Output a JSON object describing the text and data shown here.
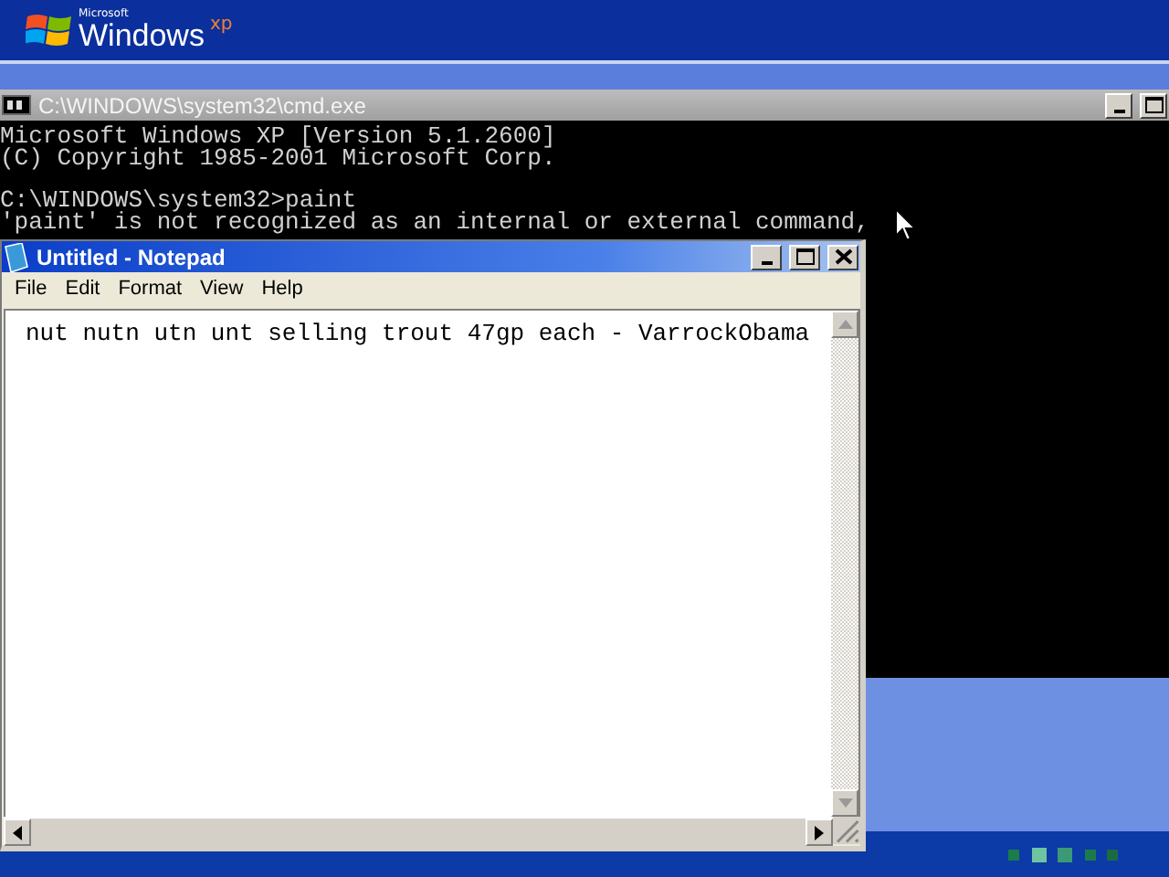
{
  "banner": {
    "brand_small": "Microsoft",
    "brand": "Windows",
    "brand_suffix": "xp"
  },
  "console_window": {
    "title": "C:\\WINDOWS\\system32\\cmd.exe",
    "active": false,
    "paragraphs": [
      [
        "Microsoft Windows XP [Version 5.1.2600]",
        "(C) Copyright 1985-2001 Microsoft Corp."
      ],
      [
        "C:\\WINDOWS\\system32>paint",
        "'paint' is not recognized as an internal or external command,"
      ]
    ]
  },
  "notepad_window": {
    "title": "Untitled - Notepad",
    "active": true,
    "menu": [
      "File",
      "Edit",
      "Format",
      "View",
      "Help"
    ],
    "text": "nut nutn utn unt selling trout 47gp each - VarrockObama"
  }
}
